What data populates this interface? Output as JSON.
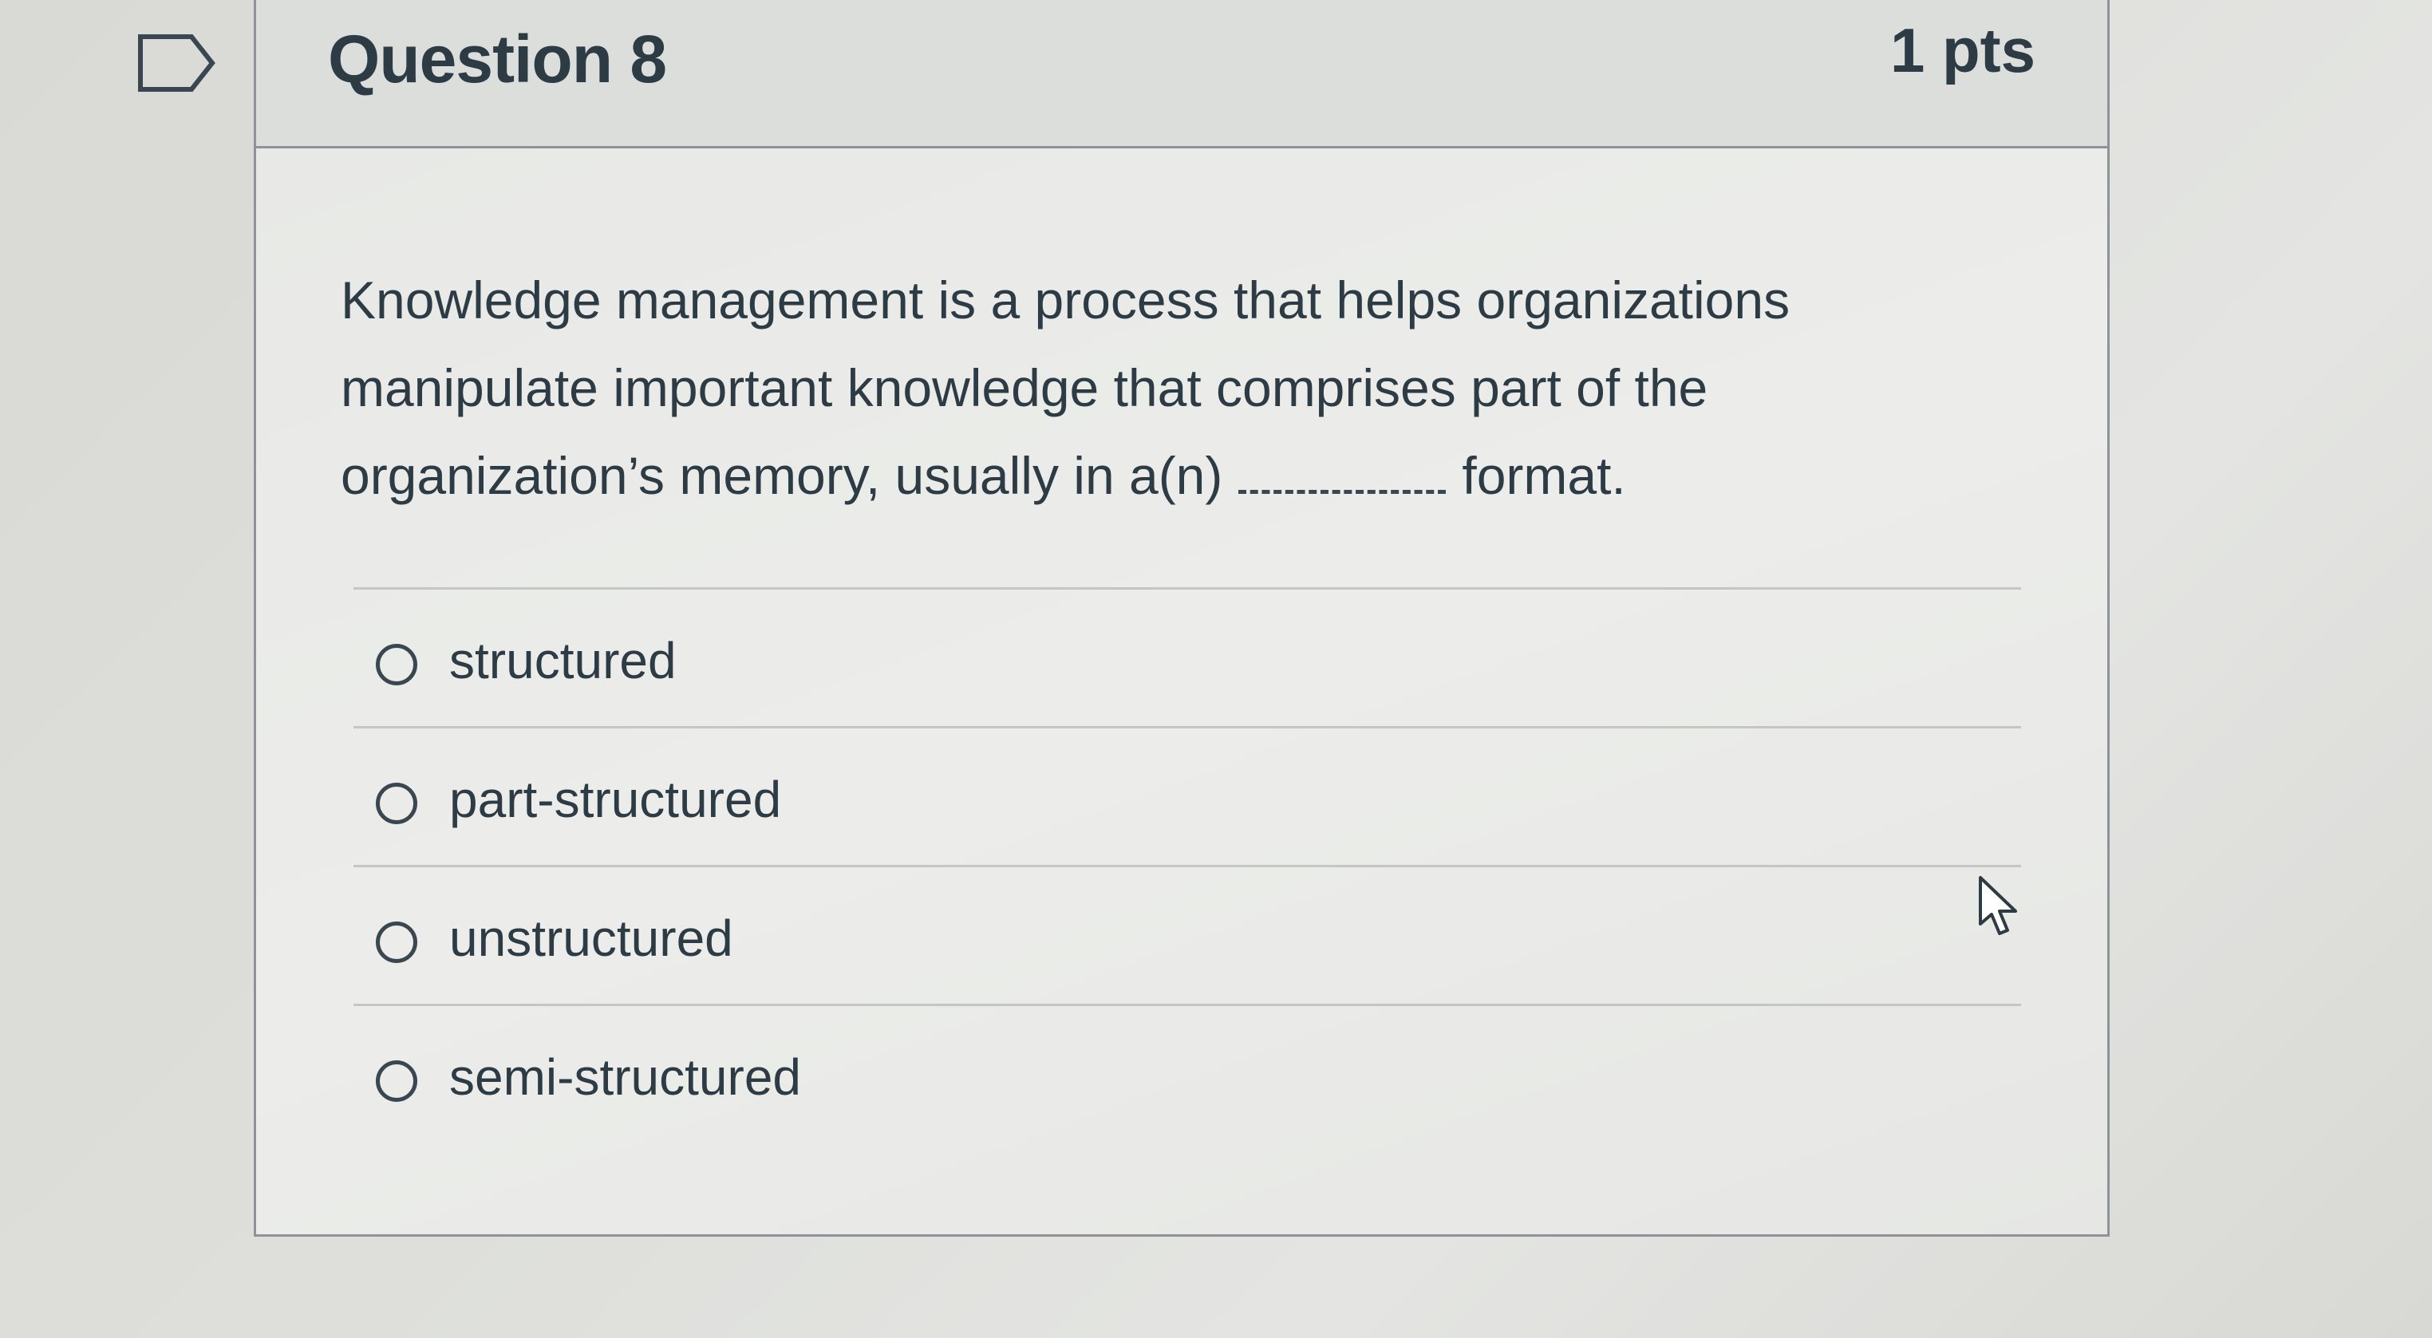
{
  "question": {
    "title": "Question 8",
    "points": "1 pts",
    "text_before_blank": "Knowledge management is a process that helps organizations manipulate important knowledge that comprises part of the organization’s memory, usually in a(n)",
    "text_after_blank": "format."
  },
  "answers": [
    {
      "label": "structured",
      "selected": false
    },
    {
      "label": "part-structured",
      "selected": false
    },
    {
      "label": "unstructured",
      "selected": false
    },
    {
      "label": "semi-structured",
      "selected": false
    }
  ],
  "icons": {
    "flag": "bookmark-flag-icon",
    "cursor": "mouse-pointer-icon",
    "radio": "radio-button-icon"
  },
  "colors": {
    "text": "#2d3b45",
    "border": "#8f9397",
    "background": "#dedfdb"
  }
}
